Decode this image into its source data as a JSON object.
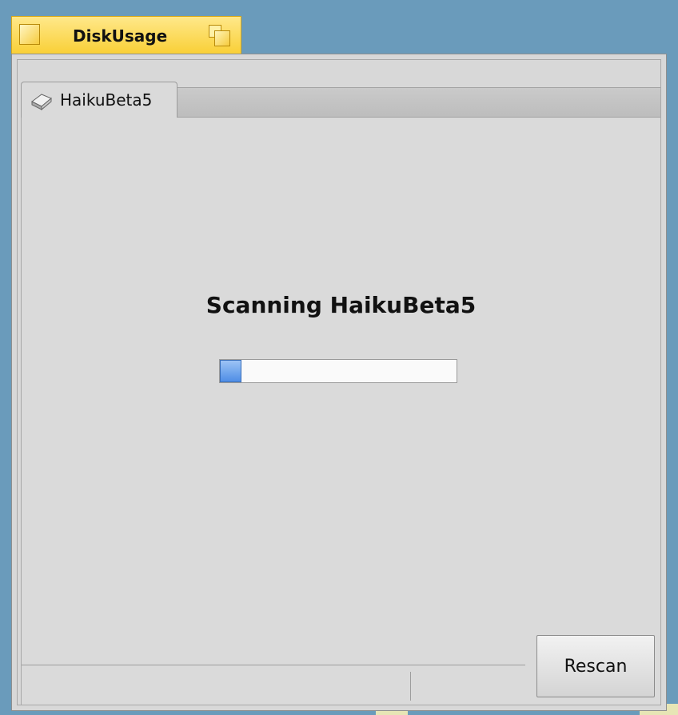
{
  "window": {
    "title": "DiskUsage"
  },
  "tabs": [
    {
      "label": "HaikuBeta5",
      "icon": "disk-volume-icon",
      "selected": true
    }
  ],
  "scan": {
    "message": "Scanning HaikuBeta5",
    "progress_percent": 9
  },
  "buttons": {
    "rescan_label": "Rescan"
  },
  "colors": {
    "window_tab": "#f9cf35",
    "progress_fill": "#4f8ee6",
    "desktop": "#6a9bbb"
  }
}
